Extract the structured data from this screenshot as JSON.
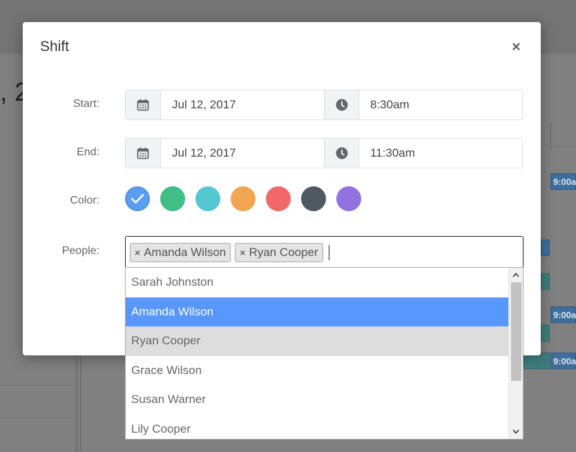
{
  "background": {
    "fragment_text": ", 2",
    "event_time": "9:00a"
  },
  "modal": {
    "title": "Shift",
    "close_label": "×",
    "start": {
      "label": "Start:",
      "date": "Jul 12, 2017",
      "time": "8:30am"
    },
    "end": {
      "label": "End:",
      "date": "Jul 12, 2017",
      "time": "11:30am"
    },
    "color": {
      "label": "Color:",
      "swatches": [
        "#5b9ef1",
        "#3fbf86",
        "#55c7d3",
        "#f2a550",
        "#f26767",
        "#4f5963",
        "#9272df"
      ],
      "selected_index": 0
    },
    "people": {
      "label": "People:",
      "selected": [
        "Amanda Wilson",
        "Ryan Cooper"
      ],
      "tag_remove": "×"
    }
  },
  "dropdown": {
    "options": [
      "Sarah Johnston",
      "Amanda Wilson",
      "Ryan Cooper",
      "Grace Wilson",
      "Susan Warner",
      "Lily Cooper"
    ],
    "highlighted": "Amanda Wilson"
  },
  "icons": {
    "date": "calendar-icon",
    "time": "clock-icon",
    "check": "check-icon"
  }
}
